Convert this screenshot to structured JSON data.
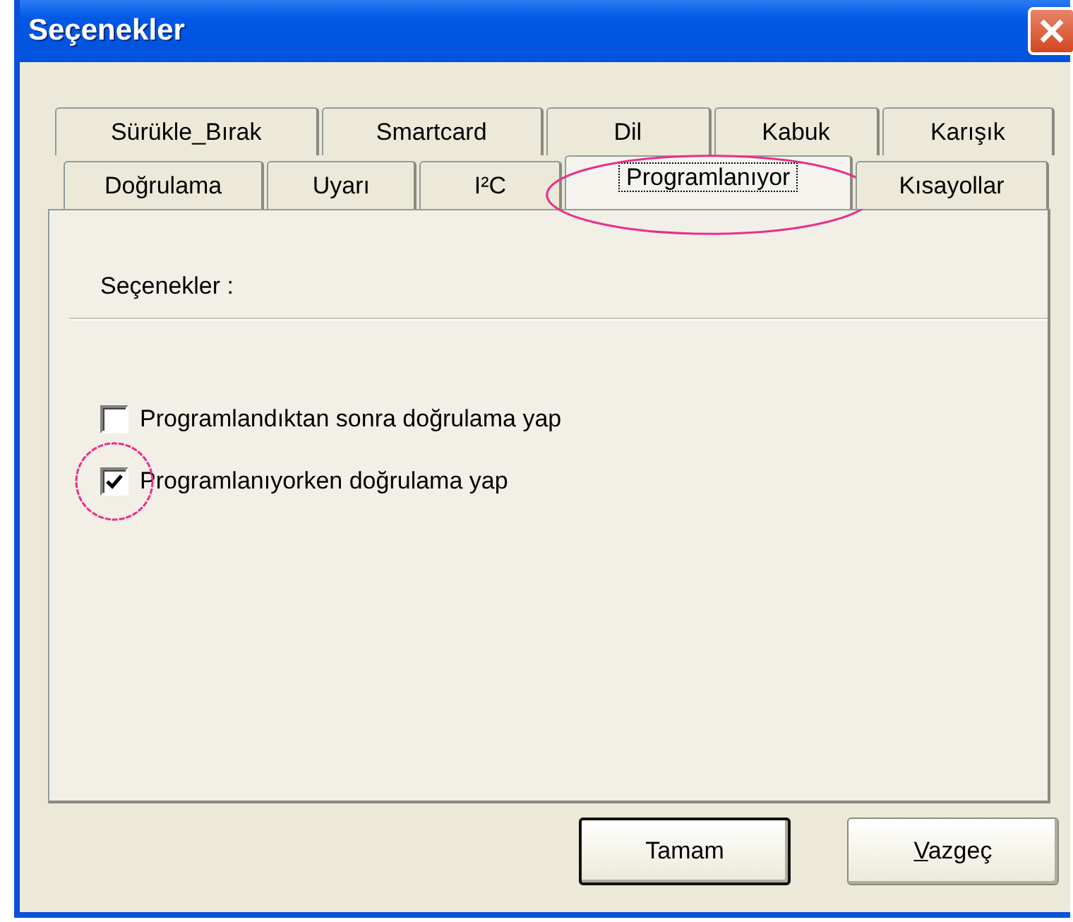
{
  "window": {
    "title": "Seçenekler"
  },
  "tab_rows": [
    [
      {
        "label": "Sürükle_Bırak",
        "selected": false,
        "highlighted": false
      },
      {
        "label": "Smartcard",
        "selected": false,
        "highlighted": false
      },
      {
        "label": "Dil",
        "selected": false,
        "highlighted": false
      },
      {
        "label": "Kabuk",
        "selected": false,
        "highlighted": false
      },
      {
        "label": "Karışık",
        "selected": false,
        "highlighted": false
      }
    ],
    [
      {
        "label": "Doğrulama",
        "selected": false,
        "highlighted": false
      },
      {
        "label": "Uyarı",
        "selected": false,
        "highlighted": false
      },
      {
        "label": "I²C",
        "selected": false,
        "highlighted": false
      },
      {
        "label": "Programlanıyor",
        "selected": true,
        "highlighted": true
      },
      {
        "label": "Kısayollar",
        "selected": false,
        "highlighted": false
      }
    ]
  ],
  "group": {
    "label": "Seçenekler :"
  },
  "options": [
    {
      "label": "Programlandıktan sonra doğrulama yap",
      "checked": false,
      "highlighted": false
    },
    {
      "label": "Programlanıyorken doğrulama yap",
      "checked": true,
      "highlighted": true
    }
  ],
  "buttons": [
    {
      "label": "Tamam",
      "default": true,
      "underline_first": false
    },
    {
      "label": "Vazgeç",
      "default": false,
      "underline_first": true
    }
  ]
}
